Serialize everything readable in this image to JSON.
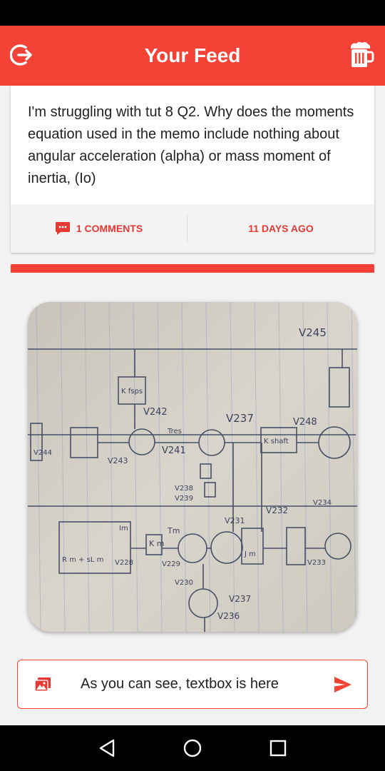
{
  "app": {
    "title": "Your Feed"
  },
  "icons": {
    "logout": "logout-icon",
    "beer": "beer-mug-icon",
    "comment": "comment-icon",
    "gallery": "gallery-icon",
    "send": "send-icon"
  },
  "colors": {
    "accent": "#f44336",
    "accent_text": "#e53935",
    "background": "#f2f2f2",
    "card": "#ffffff"
  },
  "post": {
    "text": "I'm struggling with tut 8 Q2. Why does the moments equation used in the memo include nothing about angular acceleration (alpha) or mass moment of inertia, (Io)",
    "comments_label": "1 COMMENTS",
    "time_ago": "11 DAYS AGO"
  },
  "photo": {
    "labels": [
      "V245",
      "V242",
      "V237",
      "V248",
      "V241",
      "V244",
      "V243",
      "V238",
      "V239",
      "V231",
      "V232",
      "V234",
      "V233",
      "V228",
      "V229",
      "V230",
      "V237",
      "V236",
      "K_fsps",
      "K_shaft",
      "J_m",
      "K_m",
      "R_m+sL_m",
      "Tres",
      "Tm",
      "Im"
    ]
  },
  "composer": {
    "value": "As you can see, textbox is here"
  },
  "navigation": {
    "back": "back-icon",
    "home": "home-icon",
    "recents": "recents-icon"
  }
}
